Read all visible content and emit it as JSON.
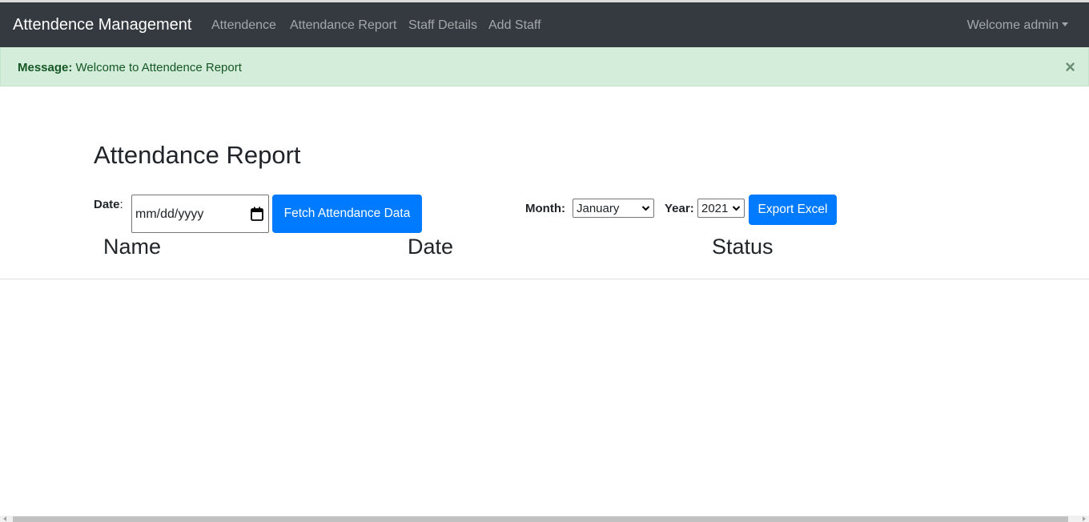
{
  "navbar": {
    "brand": "Attendence Management",
    "links": [
      {
        "label": "Attendence"
      },
      {
        "label": "Attendance Report"
      },
      {
        "label": "Staff Details"
      },
      {
        "label": "Add Staff"
      }
    ],
    "user_menu": "Welcome admin"
  },
  "alert": {
    "strong": "Message:",
    "text": " Welcome to Attendence Report",
    "close": "×"
  },
  "page": {
    "title": "Attendance Report"
  },
  "filters": {
    "date_label": "Date",
    "date_colon": ":",
    "date_placeholder": "mm/dd/yyyy",
    "fetch_button": "Fetch Attendance Data",
    "month_label": "Month:",
    "month_selected": "January",
    "year_label": "Year:",
    "year_selected": "2021",
    "export_button": "Export Excel"
  },
  "table": {
    "headers": [
      "Name",
      "Date",
      "Status"
    ],
    "rows": []
  },
  "colors": {
    "navbar_bg": "#343a40",
    "alert_bg": "#d4edda",
    "alert_text": "#155724",
    "primary": "#007bff"
  }
}
